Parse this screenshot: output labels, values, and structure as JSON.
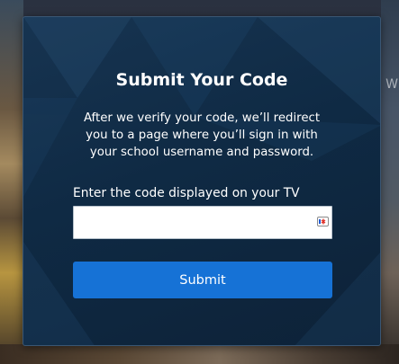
{
  "form": {
    "title": "Submit Your Code",
    "description": "After we verify your code, we’ll redirect you to a page where you’ll sign in with your school username and password.",
    "code_label": "Enter the code displayed on your TV",
    "code_value": "",
    "code_placeholder": "",
    "submit_label": "Submit"
  },
  "background": {
    "wordmark_fragment": "W"
  },
  "colors": {
    "card_background": "#0f2a44",
    "button_primary": "#1672d6",
    "text_primary": "#ffffff"
  },
  "icons": {
    "password_manager": "password-manager-icon"
  }
}
